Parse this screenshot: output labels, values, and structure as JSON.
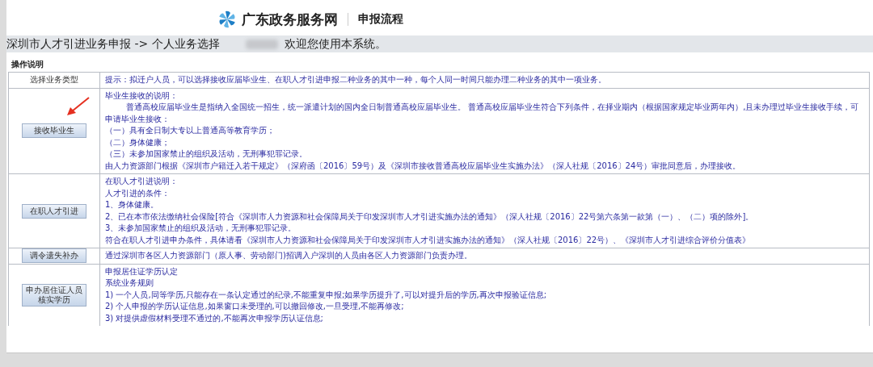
{
  "header": {
    "site_name": "广东政务服务网",
    "section_title": "申报流程"
  },
  "breadcrumb": {
    "path": "深圳市人才引进业务申报 -> 个人业务选择",
    "welcome": "欢迎您使用本系统。"
  },
  "section_label": "操作说明",
  "rows": [
    {
      "kind": "label",
      "label": "选择业务类型",
      "lines": [
        {
          "text": "提示：拟迁户人员，可以选择接收应届毕业生、在职人才引进申报二种业务的其中一种，每个人同一时间只能办理二种业务的其中一项业务。",
          "indented": false
        }
      ]
    },
    {
      "kind": "button",
      "label": "接收毕业生",
      "annotated": true,
      "lines": [
        {
          "text": "毕业生接收的说明：",
          "indented": false
        },
        {
          "text": "普通高校应届毕业生是指纳入全国统一招生，统一派遣计划的国内全日制普通高校应届毕业生。 普通高校应届毕业生符合下列条件，在择业期内（根据国家规定毕业两年内）,且未办理过毕业生接收手续，可申请毕业生接收：",
          "indented": true
        },
        {
          "text": "（一）具有全日制大专以上普通高等教育学历；",
          "indented": false
        },
        {
          "text": "（二）身体健康；",
          "indented": false
        },
        {
          "text": "（三）未参加国家禁止的组织及活动，无刑事犯罪记录。",
          "indented": false
        },
        {
          "text": "由人力资源部门根据《深圳市户籍迁入若干规定》（深府函〔2016〕59号）及《深圳市接收普通高校应届毕业生实施办法》（深人社规〔2016〕24号）审批同意后，办理接收。",
          "indented": false
        }
      ]
    },
    {
      "kind": "button",
      "label": "在职人才引进",
      "annotated": false,
      "lines": [
        {
          "text": "在职人才引进说明：",
          "indented": false
        },
        {
          "text": "人才引进的条件：",
          "indented": false
        },
        {
          "text": "1、身体健康。",
          "indented": false
        },
        {
          "text": "2、已在本市依法缴纳社会保险[符合《深圳市人力资源和社会保障局关于印发深圳市人才引进实施办法的通知》（深人社规〔2016〕22号第六条第一款第（一）、（二）项的除外]。",
          "indented": false
        },
        {
          "text": "3、未参加国家禁止的组织及活动，无刑事犯罪记录。",
          "indented": false
        },
        {
          "text": "符合在职人才引进申办条件，具体请看《深圳市人力资源和社会保障局关于印发深圳市人才引进实施办法的通知》（深人社规〔2016〕22号）、《深圳市人才引进综合评价分值表》",
          "indented": false
        }
      ]
    },
    {
      "kind": "button",
      "label": "调令遗失补办",
      "annotated": false,
      "lines": [
        {
          "text": "通过深圳市各区人力资源部门（原人事、劳动部门)招调入户深圳的人员由各区人力资源部门负责办理。",
          "indented": false
        }
      ]
    },
    {
      "kind": "button",
      "label": "申办居住证人员核实学历",
      "annotated": false,
      "lines": [
        {
          "text": "申报居住证学历认定",
          "indented": false
        },
        {
          "text": "系统业务规则",
          "indented": false
        },
        {
          "text": "1) 一个人员,同等学历,只能存在一条认定通过的纪录,不能重复申报;如果学历提升了,可以对提升后的学历,再次申报验证信息;",
          "indented": false
        },
        {
          "text": "2) 个人申报的学历认证信息,如果窗口未受理的,可以撤回修改,一旦受理,不能再修改;",
          "indented": false
        },
        {
          "text": "3) 对提供虚假材料受理不通过的,不能再次申报学历认证信息;",
          "indented": false
        }
      ]
    }
  ]
}
